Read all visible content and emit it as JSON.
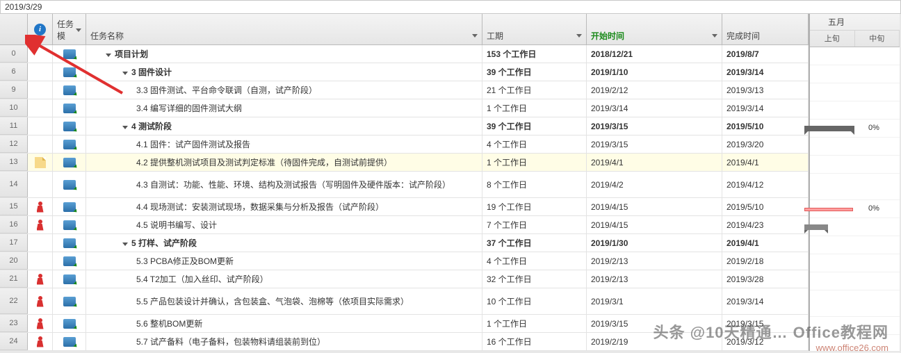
{
  "top_date": "2019/3/29",
  "columns": {
    "mode": "任务模",
    "name": "任务名称",
    "duration": "工期",
    "start": "开始时间",
    "finish": "完成时间"
  },
  "gantt_header": {
    "month": "五月",
    "sub1": "上旬",
    "sub2": "中旬",
    "pct1": "0%",
    "pct2": "0%"
  },
  "rows": [
    {
      "num": "0",
      "info": "",
      "name_pad": "ind-1",
      "tri": true,
      "bold": true,
      "name": "项目计划",
      "dur": "153 个工作日",
      "start": "2018/12/21",
      "finish": "2019/8/7"
    },
    {
      "num": "6",
      "info": "",
      "name_pad": "ind-2",
      "tri": true,
      "bold": true,
      "name": "3 固件设计",
      "dur": "39 个工作日",
      "start": "2019/1/10",
      "finish": "2019/3/14"
    },
    {
      "num": "9",
      "info": "",
      "name_pad": "ind-3",
      "tri": false,
      "bold": false,
      "name": "3.3 固件测试、平台命令联调（自测，试产阶段）",
      "dur": "21 个工作日",
      "start": "2019/2/12",
      "finish": "2019/3/13"
    },
    {
      "num": "10",
      "info": "",
      "name_pad": "ind-3",
      "tri": false,
      "bold": false,
      "name": "3.4 编写详细的固件测试大纲",
      "dur": "1 个工作日",
      "start": "2019/3/14",
      "finish": "2019/3/14"
    },
    {
      "num": "11",
      "info": "",
      "name_pad": "ind-2",
      "tri": true,
      "bold": true,
      "name": "4 测试阶段",
      "dur": "39 个工作日",
      "start": "2019/3/15",
      "finish": "2019/5/10"
    },
    {
      "num": "12",
      "info": "",
      "name_pad": "ind-3",
      "tri": false,
      "bold": false,
      "name": "4.1 固件：试产固件测试及报告",
      "dur": "4 个工作日",
      "start": "2019/3/15",
      "finish": "2019/3/20"
    },
    {
      "num": "13",
      "info": "note",
      "name_pad": "ind-3",
      "tri": false,
      "bold": false,
      "name": "4.2 提供整机测试项目及测试判定标准（待固件完成，自测试前提供）",
      "dur": "1 个工作日",
      "start": "2019/4/1",
      "finish": "2019/4/1",
      "sel": true
    },
    {
      "num": "14",
      "info": "",
      "name_pad": "ind-3",
      "tri": false,
      "bold": false,
      "name": "4.3 自测试：功能、性能、环境、结构及测试报告（写明固件及硬件版本：试产阶段）",
      "dur": "8 个工作日",
      "start": "2019/4/2",
      "finish": "2019/4/12",
      "tall": true
    },
    {
      "num": "15",
      "info": "person",
      "name_pad": "ind-3",
      "tri": false,
      "bold": false,
      "name": "4.4 现场测试：安装测试现场，数据采集与分析及报告（试产阶段）",
      "dur": "19 个工作日",
      "start": "2019/4/15",
      "finish": "2019/5/10"
    },
    {
      "num": "16",
      "info": "person",
      "name_pad": "ind-3",
      "tri": false,
      "bold": false,
      "name": "4.5 说明书编写、设计",
      "dur": "7 个工作日",
      "start": "2019/4/15",
      "finish": "2019/4/23"
    },
    {
      "num": "17",
      "info": "",
      "name_pad": "ind-2",
      "tri": true,
      "bold": true,
      "name": "5 打样、试产阶段",
      "dur": "37 个工作日",
      "start": "2019/1/30",
      "finish": "2019/4/1"
    },
    {
      "num": "20",
      "info": "",
      "name_pad": "ind-3",
      "tri": false,
      "bold": false,
      "name": "5.3 PCBA修正及BOM更新",
      "dur": "4 个工作日",
      "start": "2019/2/13",
      "finish": "2019/2/18"
    },
    {
      "num": "21",
      "info": "person",
      "name_pad": "ind-3",
      "tri": false,
      "bold": false,
      "name": "5.4 T2加工（加入丝印、试产阶段）",
      "dur": "32 个工作日",
      "start": "2019/2/13",
      "finish": "2019/3/28"
    },
    {
      "num": "22",
      "info": "person",
      "name_pad": "ind-3",
      "tri": false,
      "bold": false,
      "name": "5.5 产品包装设计并确认，含包装盒、气泡袋、泡棉等（依项目实际需求）",
      "dur": "10 个工作日",
      "start": "2019/3/1",
      "finish": "2019/3/14",
      "tall": true
    },
    {
      "num": "23",
      "info": "person",
      "name_pad": "ind-3",
      "tri": false,
      "bold": false,
      "name": "5.6 整机BOM更新",
      "dur": "1 个工作日",
      "start": "2019/3/15",
      "finish": "2019/3/15"
    },
    {
      "num": "24",
      "info": "person",
      "name_pad": "ind-3",
      "tri": false,
      "bold": false,
      "name": "5.7 试产备料（电子备料，包装物料请组装前到位）",
      "dur": "16 个工作日",
      "start": "2019/2/19",
      "finish": "2019/3/12"
    }
  ],
  "watermark": "头条 @10天精通… Office教程网",
  "watermark_url": "www.office26.com"
}
